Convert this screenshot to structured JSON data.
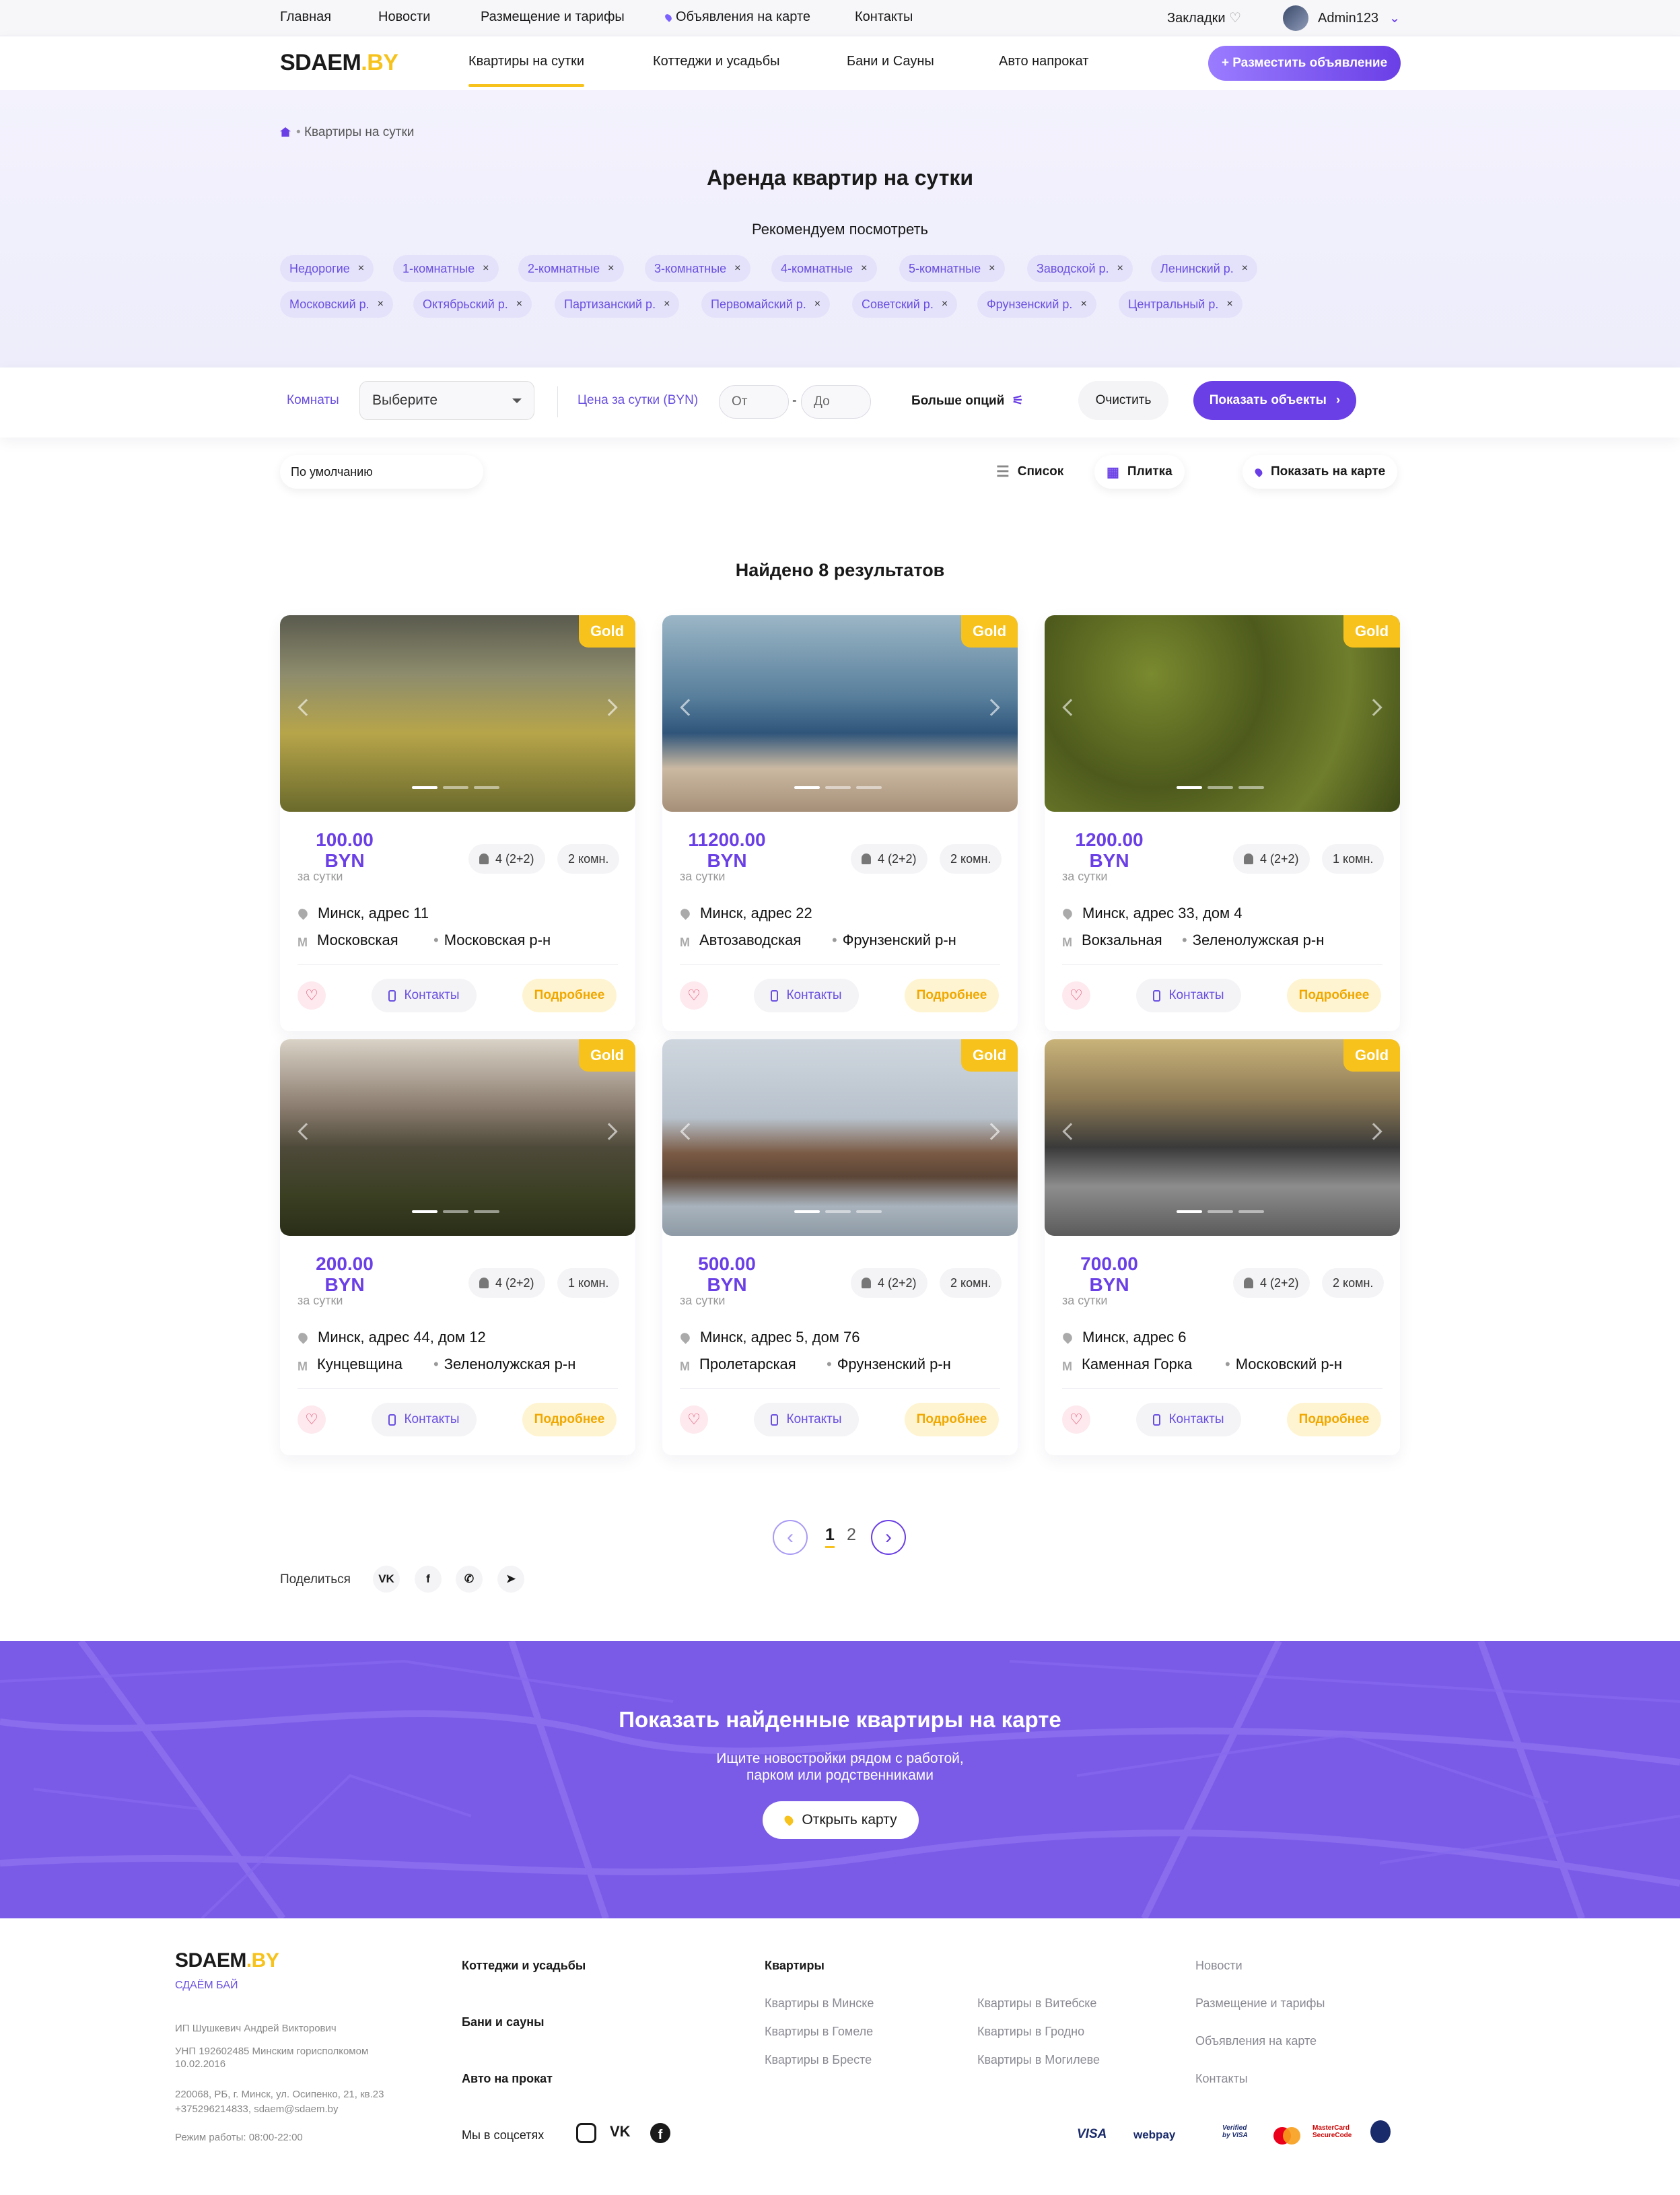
{
  "topbar": {
    "links": [
      "Главная",
      "Новости",
      "Размещение и тарифы",
      "Объявления на карте",
      "Контакты"
    ],
    "bookmarks": "Закладки",
    "user": "Admin123"
  },
  "header": {
    "logo_main": "SDAEM",
    "logo_dot": ".BY",
    "nav": [
      "Квартиры на сутки",
      "Коттеджи и усадьбы",
      "Бани и Сауны",
      "Авто напрокат"
    ],
    "place_button": "+ Разместить объявление"
  },
  "hero": {
    "breadcrumb": "Квартиры на сутки",
    "title": "Аренда квартир на сутки",
    "recommend": "Рекомендуем посмотреть",
    "chips_row1": [
      "Недорогие",
      "1-комнатные",
      "2-комнатные",
      "3-комнатные",
      "4-комнатные",
      "5-комнатные",
      "Заводской р.",
      "Ленинский р."
    ],
    "chips_row2": [
      "Московский р.",
      "Октябрьский р.",
      "Партизанский р.",
      "Первомайский р.",
      "Советский р.",
      "Фрунзенский р.",
      "Центральный р."
    ]
  },
  "filter": {
    "rooms_label": "Комнаты",
    "rooms_value": "Выберите",
    "price_label": "Цена за сутки (BYN)",
    "from_placeholder": "От",
    "to_placeholder": "До",
    "more_options": "Больше опций",
    "clear": "Очистить",
    "show": "Показать объекты"
  },
  "sort": {
    "value": "По умолчанию",
    "list": "Список",
    "tile": "Плитка",
    "map": "Показать на карте"
  },
  "results_title": "Найдено 8 результатов",
  "card_labels": {
    "badge": "Gold",
    "per": "за сутки",
    "contacts": "Контакты",
    "more": "Подробнее"
  },
  "cards": [
    {
      "price": "100.00",
      "currency": "BYN",
      "guests": "4 (2+2)",
      "rooms": "2 комн.",
      "address": "Минск, адрес 11",
      "metro": "Московская",
      "district": "Московская р-н"
    },
    {
      "price": "11200.00",
      "currency": "BYN",
      "guests": "4 (2+2)",
      "rooms": "2 комн.",
      "address": "Минск, адрес 22",
      "metro": "Автозаводская",
      "district": "Фрунзенский р-н"
    },
    {
      "price": "1200.00",
      "currency": "BYN",
      "guests": "4 (2+2)",
      "rooms": "1 комн.",
      "address": "Минск, адрес 33, дом 4",
      "metro": "Вокзальная",
      "district": "Зеленолужская р-н"
    },
    {
      "price": "200.00",
      "currency": "BYN",
      "guests": "4 (2+2)",
      "rooms": "1 комн.",
      "address": "Минск, адрес 44, дом 12",
      "metro": "Кунцевщина",
      "district": "Зеленолужская р-н"
    },
    {
      "price": "500.00",
      "currency": "BYN",
      "guests": "4 (2+2)",
      "rooms": "2 комн.",
      "address": "Минск, адрес 5, дом 76",
      "metro": "Пролетарская",
      "district": "Фрунзенский р-н"
    },
    {
      "price": "700.00",
      "currency": "BYN",
      "guests": "4 (2+2)",
      "rooms": "2 комн.",
      "address": "Минск, адрес 6",
      "metro": "Каменная Горка",
      "district": "Московский р-н"
    }
  ],
  "pagination": {
    "pages": [
      "1",
      "2"
    ],
    "current": "1"
  },
  "share": {
    "label": "Поделиться",
    "networks": [
      "VK",
      "f",
      "✆",
      "➤"
    ]
  },
  "map_banner": {
    "title": "Показать найденные квартиры на карте",
    "subtitle_1": "Ищите новостройки рядом с работой,",
    "subtitle_2": "парком или родственниками",
    "button": "Открыть карту"
  },
  "footer": {
    "logo_main": "SDAEM",
    "logo_dot": ".BY",
    "tagline": "СДАЁМ БАЙ",
    "company": "ИП Шушкевич Андрей Викторович",
    "unp": "УНП 192602485 Минским горисполкомом 10.02.2016",
    "address": "220068, РБ, г. Минск, ул. Осипенко, 21, кв.23",
    "contacts": "+375296214833, sdaem@sdaem.by",
    "hours": "Режим работы: 08:00-22:00",
    "col1": [
      "Коттеджи и усадьбы",
      "Бани и сауны",
      "Авто на прокат"
    ],
    "socials_label": "Мы в соцсетях",
    "apartments_title": "Квартиры",
    "apartments_a": [
      "Квартиры в Минске",
      "Квартиры в Гомеле",
      "Квартиры в Бресте"
    ],
    "apartments_b": [
      "Квартиры в Витебске",
      "Квартиры в Гродно",
      "Квартиры в Могилеве"
    ],
    "links": [
      "Новости",
      "Размещение и тарифы",
      "Объявления на карте",
      "Контакты"
    ],
    "payments": [
      "VISA",
      "webpay",
      "Verified by VISA",
      "mastercard",
      "MasterCard SecureCode",
      "belkart"
    ]
  },
  "colors": {
    "accent": "#6a3fe6",
    "brand_yellow": "#f6c21b",
    "banner": "#7a5be8"
  }
}
